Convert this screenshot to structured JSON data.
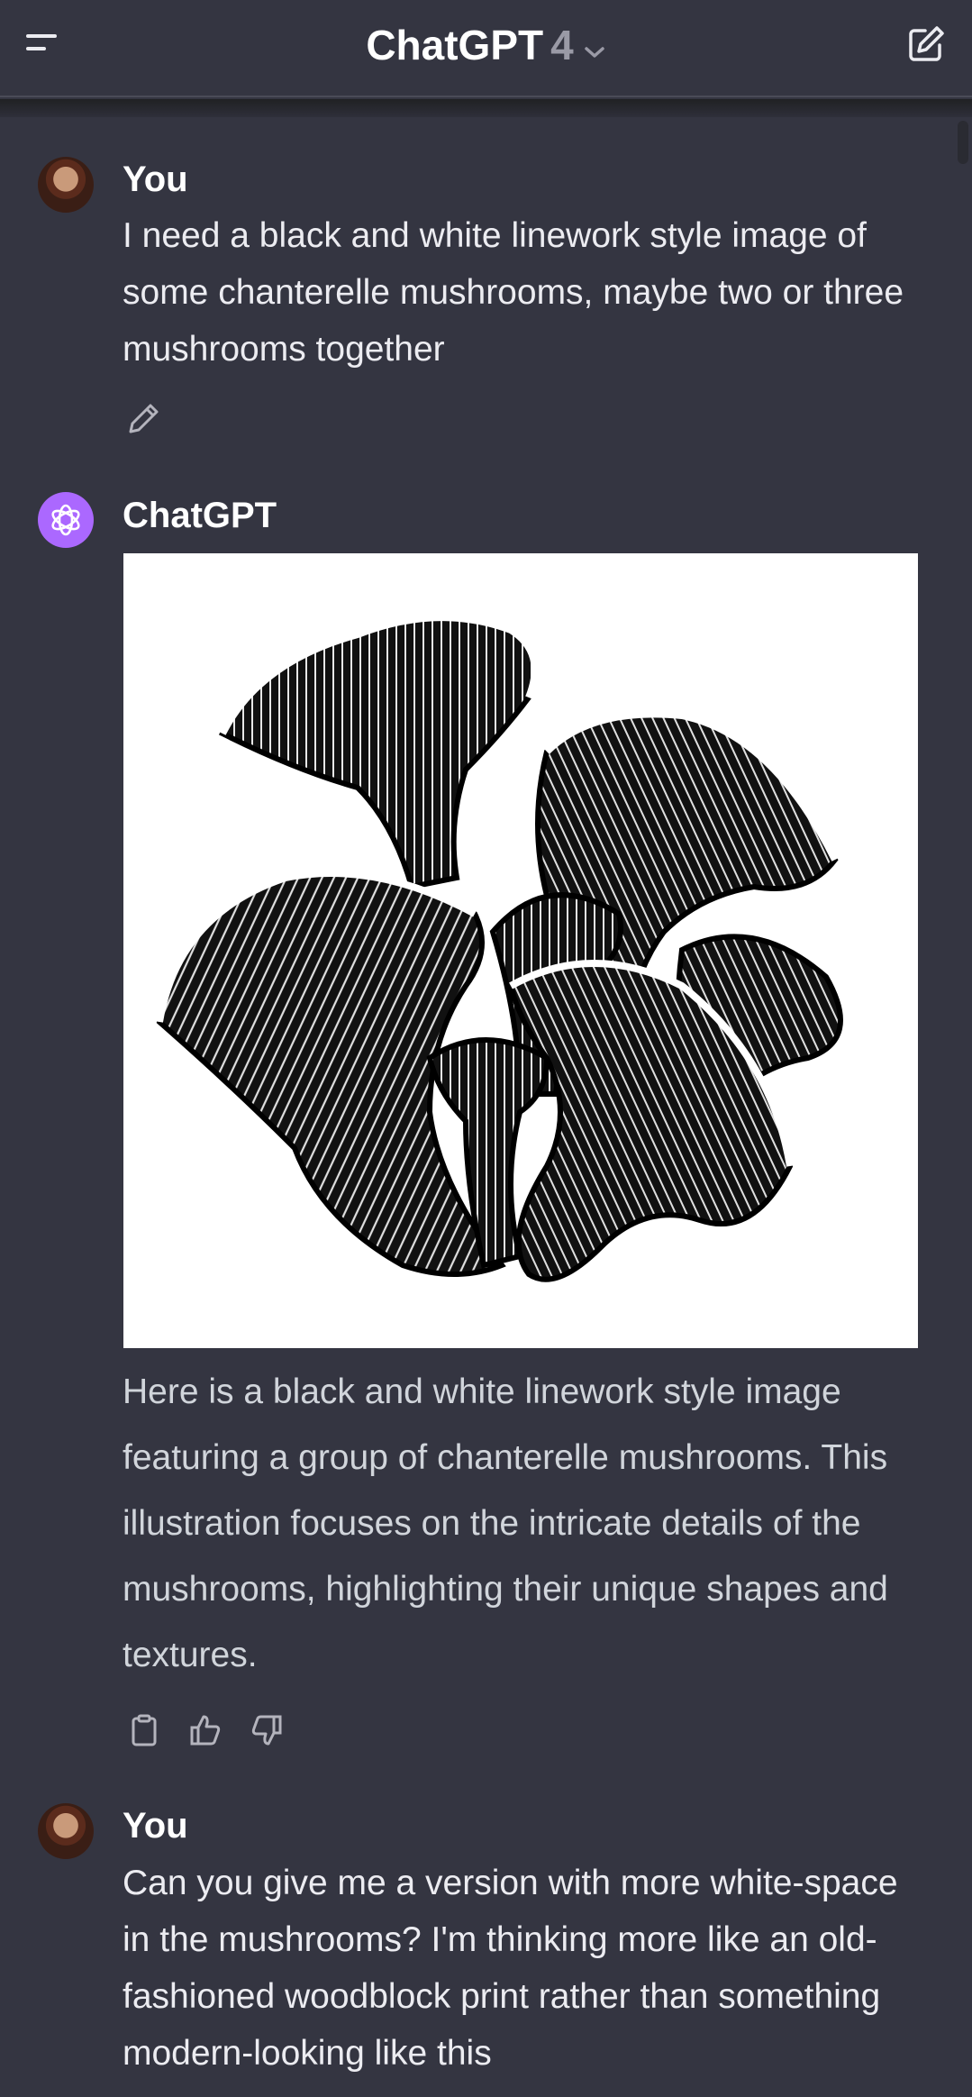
{
  "header": {
    "title": "ChatGPT",
    "model_version": "4",
    "menu_icon": "hamburger-menu-icon",
    "new_chat_icon": "new-chat-edit-icon"
  },
  "messages": [
    {
      "author": "You",
      "text": "I need a black and white linework style image of some chanterelle mushrooms, maybe two or three mushrooms together",
      "action_icon": "pencil-edit-icon"
    },
    {
      "author": "ChatGPT",
      "image_alt": "black and white linework chanterelle mushrooms",
      "text": "Here is a black and white linework style image featuring a group of chanterelle mushrooms. This illustration focuses on the intricate details of the mushrooms, highlighting their unique shapes and textures.",
      "action_icons": [
        "clipboard-icon",
        "thumbs-up-icon",
        "thumbs-down-icon"
      ]
    },
    {
      "author": "You",
      "text": "Can you give me a version with more white-space in the mushrooms?  I'm thinking more like an old-fashioned woodblock print rather than something modern-looking like this"
    }
  ],
  "colors": {
    "background": "#343541",
    "text": "#ececf1",
    "gpt_avatar": "#ab68ff"
  }
}
